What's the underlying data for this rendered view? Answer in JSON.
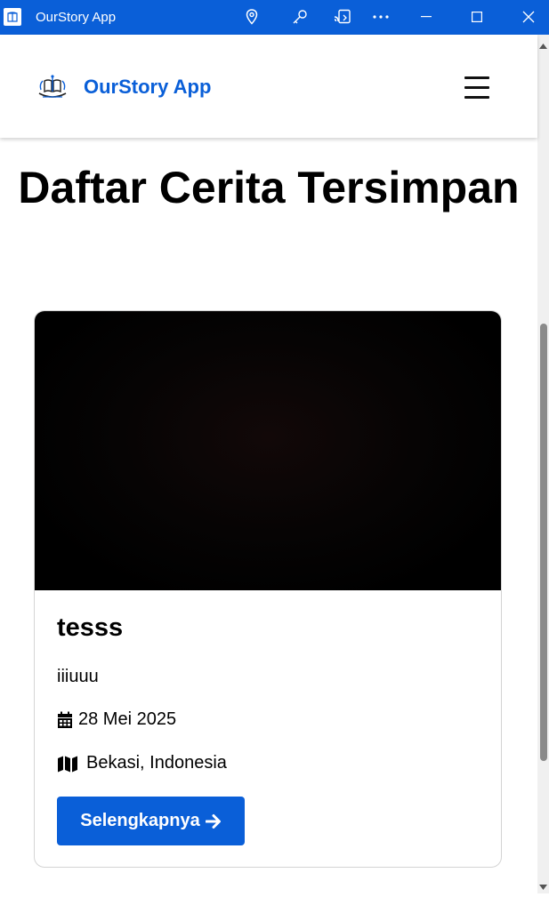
{
  "window": {
    "title": "OurStory App",
    "controls": [
      "location-icon",
      "key-icon",
      "cast-icon",
      "more-icon",
      "minimize-icon",
      "maximize-icon",
      "close-icon"
    ]
  },
  "header": {
    "brand_name": "OurStory App",
    "menu_icon": "hamburger-menu-icon"
  },
  "page": {
    "title": "Daftar Cerita Tersimpan"
  },
  "stories": [
    {
      "title": "tesss",
      "description": "iiiuuu",
      "date": "28 Mei 2025",
      "location": "Bekasi, Indonesia",
      "button_label": "Selengkapnya",
      "date_icon": "calendar-icon",
      "location_icon": "map-icon",
      "button_icon": "arrow-right-icon"
    }
  ],
  "colors": {
    "accent": "#0a5fd8",
    "titlebar": "#0a5fd8",
    "text": "#000000",
    "card_border": "#d4d4d4"
  }
}
